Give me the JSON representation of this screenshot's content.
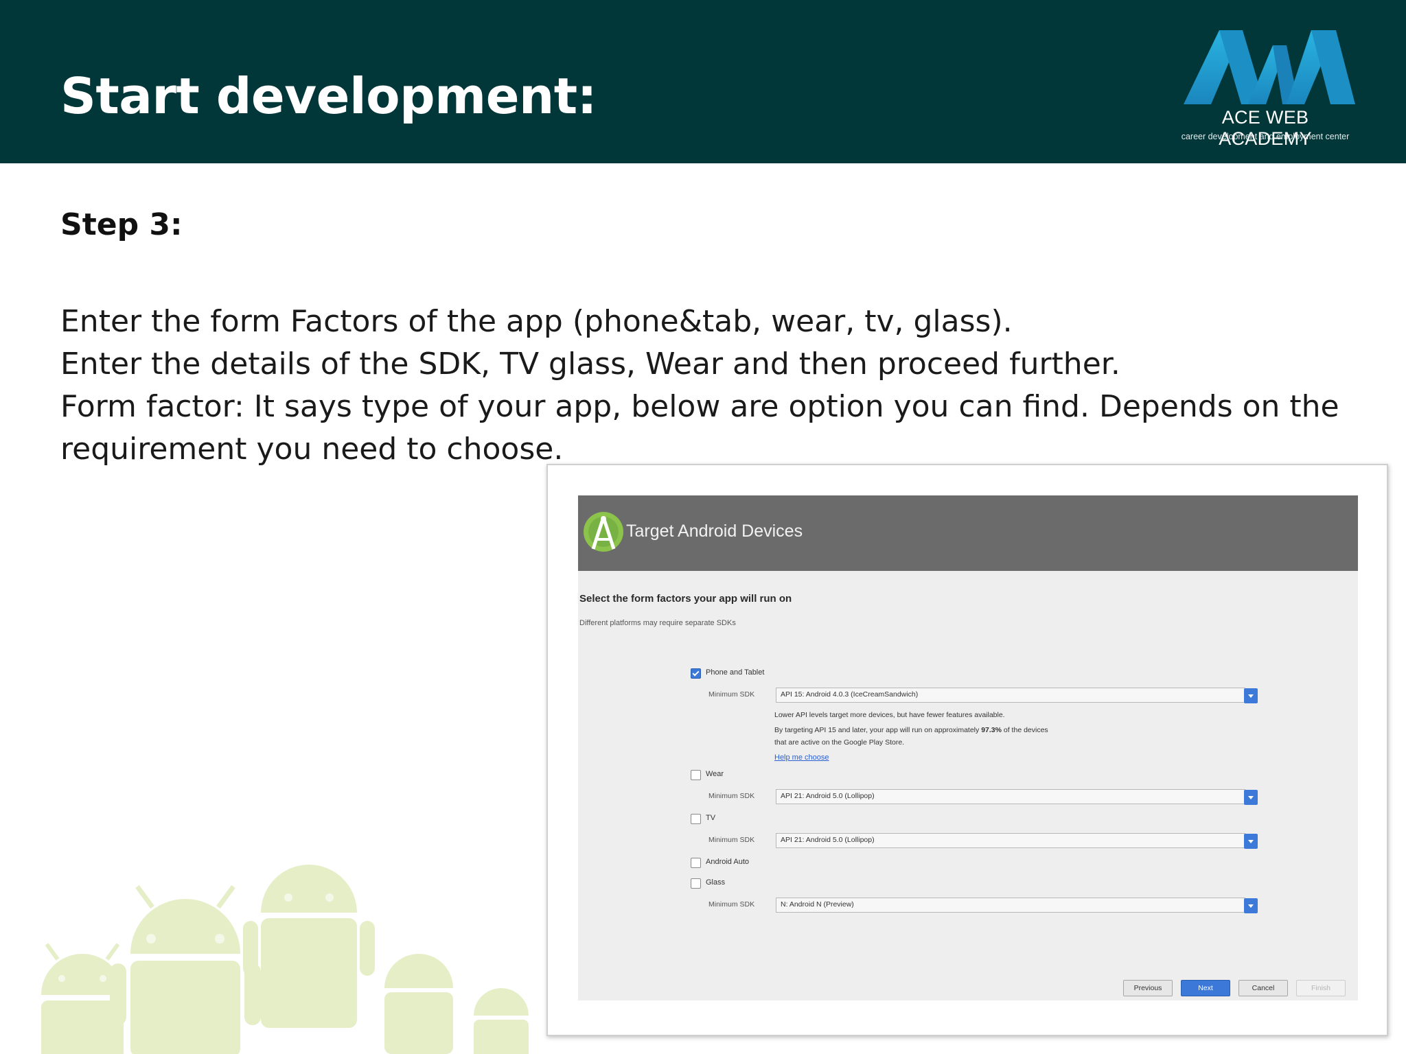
{
  "slide": {
    "title": "Start development:",
    "step_label": "Step 3:",
    "body_lines": [
      "Enter the form Factors of the app (phone&tab, wear, tv, glass).",
      "Enter the details of the SDK, TV glass, Wear and then proceed further.",
      "Form factor: It says type of your app, below are option you can find. Depends  on the",
      "requirement you need to choose."
    ]
  },
  "logo": {
    "name": "ACE WEB ACADEMY",
    "tagline": "career development and employment center",
    "colors": {
      "primary": "#2aa6d6",
      "secondary": "#1b7fb0"
    }
  },
  "colors": {
    "header_bg": "#02373a",
    "wizard_header_bg": "#6b6b6b",
    "accent_blue": "#3b78d8",
    "android_green": "#a4c639"
  },
  "wizard": {
    "title": "Target Android Devices",
    "section_title": "Select the form factors your app will run on",
    "section_subtitle": "Different platforms may require separate SDKs",
    "sdk_label": "Minimum SDK",
    "form_factors": {
      "phone_tablet": {
        "label": "Phone and Tablet",
        "checked": true,
        "min_sdk": "API 15: Android 4.0.3 (IceCreamSandwich)",
        "info_line1": "Lower API levels target more devices, but have fewer features available.",
        "info_line2_prefix": "By targeting API 15 and later, your app will run on approximately ",
        "info_percent": "97.3%",
        "info_line2_suffix": " of the devices",
        "info_line3": "that are active on the Google Play Store.",
        "help_link": "Help me choose"
      },
      "wear": {
        "label": "Wear",
        "checked": false,
        "min_sdk": "API 21: Android 5.0 (Lollipop)"
      },
      "tv": {
        "label": "TV",
        "checked": false,
        "min_sdk": "API 21: Android 5.0 (Lollipop)"
      },
      "android_auto": {
        "label": "Android Auto",
        "checked": false
      },
      "glass": {
        "label": "Glass",
        "checked": false,
        "min_sdk": "N: Android N (Preview)"
      }
    },
    "buttons": {
      "previous": "Previous",
      "next": "Next",
      "cancel": "Cancel",
      "finish": "Finish"
    }
  }
}
